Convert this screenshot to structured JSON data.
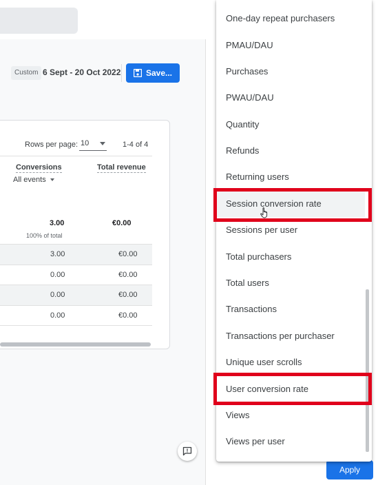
{
  "header": {
    "date_chip": "Custom",
    "date_range": "6 Sept - 20 Oct 2022",
    "save_label": "Save..."
  },
  "table": {
    "rows_per_page_label": "Rows per page:",
    "rows_per_page_value": "10",
    "page_range": "1-4 of 4",
    "columns": [
      "Conversions",
      "Total revenue"
    ],
    "event_filter": "All events",
    "totals": {
      "conversions": "3.00",
      "conversions_pct": "100% of total",
      "revenue": "€0.00"
    },
    "rows": [
      {
        "conversions": "3.00",
        "revenue": "€0.00"
      },
      {
        "conversions": "0.00",
        "revenue": "€0.00"
      },
      {
        "conversions": "0.00",
        "revenue": "€0.00"
      },
      {
        "conversions": "0.00",
        "revenue": "€0.00"
      }
    ]
  },
  "metric_menu": {
    "items": [
      "One-day repeat purchasers",
      "PMAU/DAU",
      "Purchases",
      "PWAU/DAU",
      "Quantity",
      "Refunds",
      "Returning users",
      "Session conversion rate",
      "Sessions per user",
      "Total purchasers",
      "Total users",
      "Transactions",
      "Transactions per purchaser",
      "Unique user scrolls",
      "User conversion rate",
      "Views",
      "Views per user"
    ],
    "highlighted": [
      "Session conversion rate",
      "User conversion rate"
    ],
    "hovered": "Session conversion rate"
  },
  "apply_label": "Apply",
  "colors": {
    "accent": "#1a73e8",
    "highlight": "#e0001b"
  },
  "icons": {
    "save": "save-icon",
    "feedback": "feedback-icon",
    "cursor": "hand-cursor-icon"
  }
}
